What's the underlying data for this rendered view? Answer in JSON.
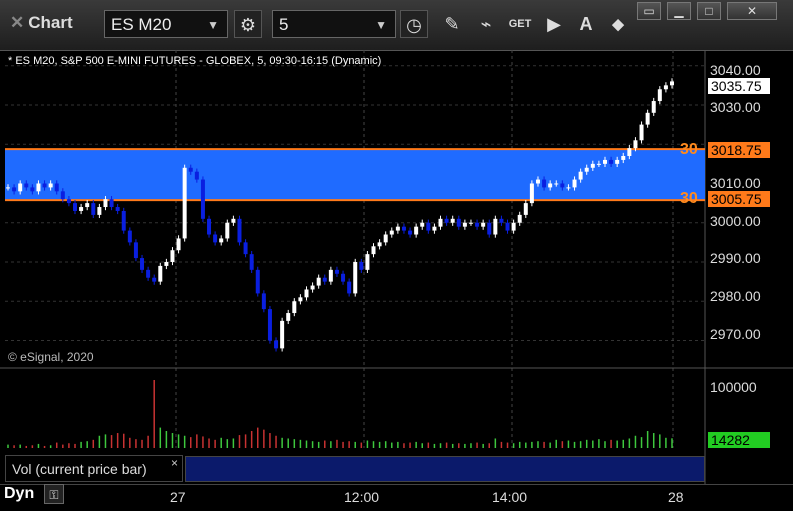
{
  "title_bar": {
    "title": "Chart",
    "symbol": "ES M20",
    "interval": "5",
    "icons": [
      "gear-icon",
      "clock-icon",
      "pencil-icon",
      "study-icon",
      "get-icon",
      "play-icon",
      "alert-icon",
      "link-icon",
      "restore-icon",
      "minimize-icon",
      "maximize-icon",
      "close-icon"
    ],
    "get_label": "GET",
    "alert_label": "A"
  },
  "chart": {
    "description": "* ES M20, S&P 500 E-MINI FUTURES - GLOBEX, 5, 09:30-16:15 (Dynamic)",
    "copyright": "© eSignal, 2020",
    "price_axis_labels": [
      "3040.00",
      "3030.00",
      "3020.00",
      "3010.00",
      "3000.00",
      "2990.00",
      "2980.00",
      "2970.00"
    ],
    "current_price_flag": "3035.75",
    "zone_upper_flag": "3018.75",
    "zone_lower_flag": "3005.75",
    "zone_level_label_upper": "30",
    "zone_level_label_lower": "30",
    "volume_axis_label": "100000",
    "volume_flag": "14282",
    "volume_panel_label": "Vol (current price bar)",
    "volume_panel_close": "×",
    "time_axis_labels": [
      "27",
      "12:00",
      "14:00",
      "28"
    ],
    "dynamic_label": "Dyn",
    "colors": {
      "zone": "#1f6bff",
      "zone_border": "#ff7a1a",
      "up": "#ffffff",
      "down": "#0a1fe0",
      "vol_up": "#3ec83e",
      "vol_down": "#c83232",
      "flag_green": "#22cc22"
    }
  },
  "chart_data": {
    "type": "candlestick",
    "title": "ES M20, S&P 500 E-MINI FUTURES - GLOBEX, 5, 09:30-16:15 (Dynamic)",
    "xlabel": "",
    "ylabel": "",
    "ylim": [
      2963,
      3044
    ],
    "x_ticks": [
      "27",
      "12:00",
      "14:00",
      "28"
    ],
    "closes": [
      3009,
      3008,
      3010,
      3009,
      3008,
      3010,
      3009,
      3010,
      3008,
      3006,
      3005,
      3003,
      3004,
      3005,
      3002,
      3004,
      3006,
      3004,
      3003,
      2998,
      2995,
      2991,
      2988,
      2986,
      2985,
      2989,
      2990,
      2993,
      2996,
      3014,
      3013,
      3011,
      3001,
      2997,
      2995,
      2996,
      3000,
      3001,
      2995,
      2992,
      2988,
      2982,
      2978,
      2970,
      2968,
      2975,
      2977,
      2980,
      2981,
      2983,
      2984,
      2986,
      2985,
      2988,
      2987,
      2985,
      2982,
      2990,
      2988,
      2992,
      2994,
      2995,
      2997,
      2998,
      2999,
      2998,
      2997,
      2999,
      3000,
      2998,
      2999,
      3001,
      3000,
      3001,
      2999,
      3000,
      3000,
      2999,
      3000,
      2997,
      3001,
      3000,
      2998,
      3000,
      3002,
      3005,
      3010,
      3011,
      3009,
      3010,
      3010,
      3009,
      3009,
      3011,
      3013,
      3014,
      3015,
      3015,
      3016,
      3015,
      3016,
      3017,
      3019,
      3021,
      3025,
      3028,
      3031,
      3034,
      3035,
      3036
    ],
    "volume": [
      5000,
      4000,
      5000,
      3000,
      4000,
      6000,
      3000,
      4000,
      8000,
      5000,
      7000,
      6000,
      9000,
      10000,
      12000,
      18000,
      20000,
      19000,
      22000,
      21000,
      15000,
      13000,
      12000,
      18000,
      100000,
      30000,
      25000,
      22000,
      20000,
      18000,
      16000,
      20000,
      17000,
      14000,
      12000,
      15000,
      13000,
      14000,
      19000,
      20000,
      25000,
      30000,
      27000,
      22000,
      18000,
      15000,
      14000,
      13000,
      12000,
      11000,
      10000,
      9000,
      11000,
      10000,
      12000,
      9000,
      10000,
      9000,
      8000,
      11000,
      10000,
      9000,
      10000,
      8000,
      9000,
      7000,
      8000,
      9000,
      7000,
      8000,
      6000,
      7000,
      8000,
      6000,
      7000,
      6000,
      7000,
      8000,
      6000,
      7000,
      14000,
      9000,
      8000,
      7000,
      9000,
      8000,
      9000,
      10000,
      9000,
      8000,
      12000,
      10000,
      11000,
      9000,
      10000,
      12000,
      11000,
      13000,
      10000,
      12000,
      11000,
      12000,
      14000,
      18000,
      16000,
      25000,
      22000,
      20000,
      15000,
      14282
    ],
    "zone": {
      "upper": 3018.75,
      "lower": 3005.75
    },
    "last_price": 3035.75
  }
}
